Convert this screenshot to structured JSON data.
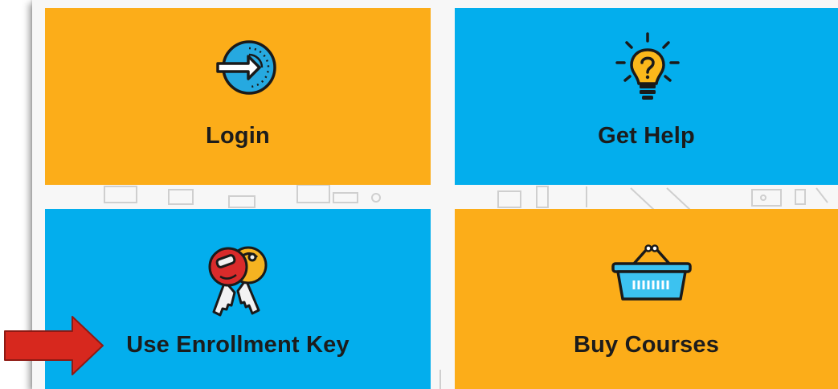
{
  "tiles": [
    {
      "id": "login",
      "label": "Login",
      "color": "#fcad19",
      "icon": "login-arrow-circle-icon"
    },
    {
      "id": "help",
      "label": "Get Help",
      "color": "#03aeed",
      "icon": "lightbulb-question-icon"
    },
    {
      "id": "key",
      "label": "Use Enrollment Key",
      "color": "#03aeed",
      "icon": "keys-icon"
    },
    {
      "id": "buy",
      "label": "Buy Courses",
      "color": "#fcad19",
      "icon": "shopping-basket-icon"
    }
  ],
  "annotation": {
    "icon": "red-arrow-pointer",
    "color": "#d7281e"
  },
  "colors": {
    "orange": "#fcad19",
    "blue": "#03aeed",
    "background": "#f7f7f7",
    "text": "#1c1c1c"
  }
}
